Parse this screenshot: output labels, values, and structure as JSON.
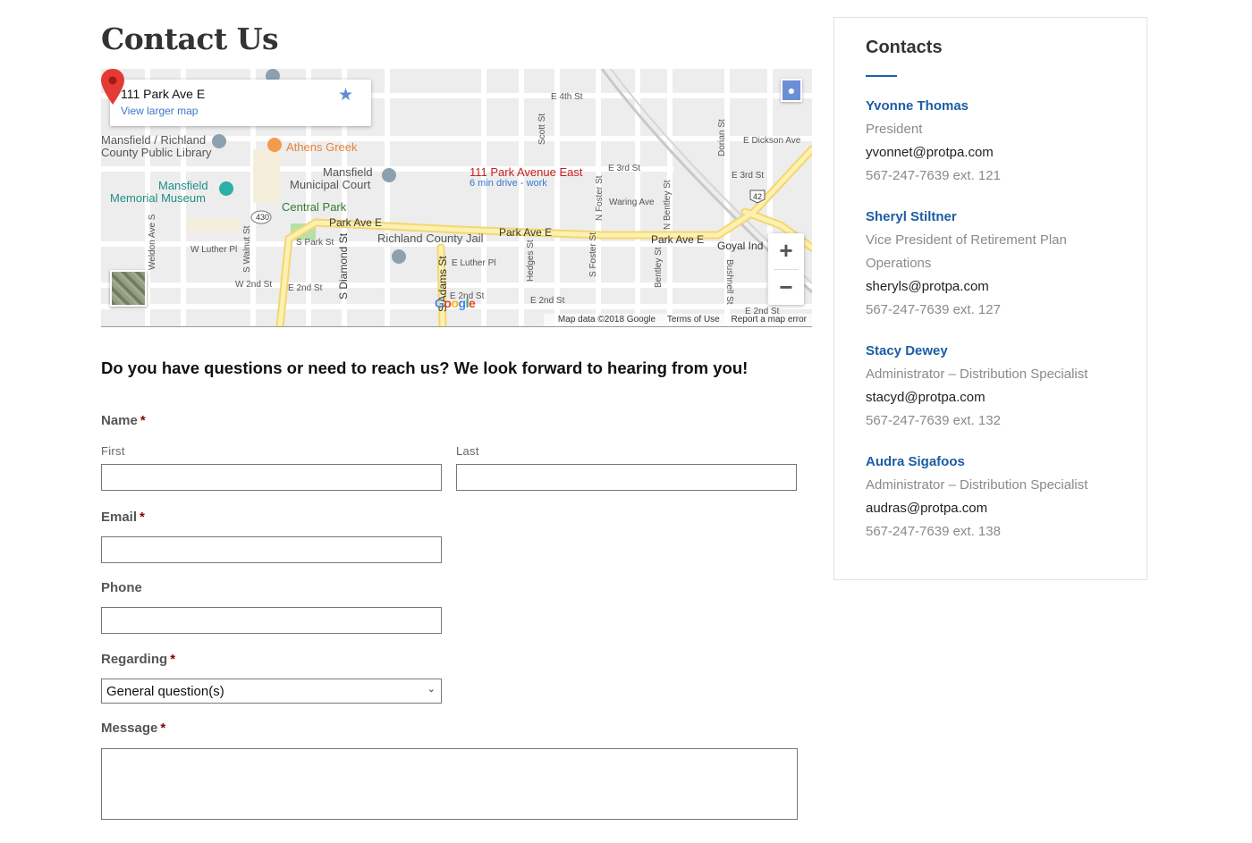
{
  "page_title": "Contact Us",
  "map": {
    "card_address": "111 Park Ave E",
    "card_link": "View larger map",
    "destination": "111 Park Avenue East",
    "destination_sub": "6 min drive - work",
    "zoom_in": "+",
    "zoom_out": "−",
    "footer_data": "Map data ©2018 Google",
    "footer_terms": "Terms of Use",
    "footer_report": "Report a map error",
    "labels": {
      "athens_greek": "Athens Greek",
      "library_1": "Mansfield / Richland",
      "library_2": "County Public Library",
      "court_1": "Mansfield",
      "court_2": "Municipal Court",
      "museum_1": "Mansfield",
      "museum_2": "Memorial Museum",
      "central_park": "Central Park",
      "jail": "Richland County Jail",
      "park_ave_1": "Park Ave E",
      "park_ave_2": "Park Ave E",
      "park_ave_3": "Park Ave E",
      "goyal": "Goyal Ind",
      "e4th": "E 4th St",
      "e3rd_1": "E 3rd St",
      "e3rd_2": "E 3rd St",
      "dickson": "E Dickson Ave",
      "waring": "Waring Ave",
      "w_luther": "W Luther Pl",
      "e_luther": "E Luther Pl",
      "w2nd": "W 2nd St",
      "e2nd_1": "E 2nd St",
      "e2nd_2": "E 2nd St",
      "e2nd_3": "E 2nd St",
      "e2nd_4": "E 2nd St",
      "s_park": "S Park St",
      "scott": "Scott St",
      "dorian": "Dorian St",
      "s_foster": "S Foster St",
      "n_foster": "N Foster St",
      "n_bentley": "N Bentley St",
      "bentley": "Bentley St",
      "hedges": "Hedges St",
      "bushnell": "Bushnell St",
      "s_walnut": "S Walnut St",
      "s_diamond": "S Diamond St",
      "s_adams": "S Adams St",
      "weldon": "Weldon Ave S",
      "route_430": "430",
      "route_42": "42",
      "google": "Google"
    }
  },
  "form": {
    "intro": "Do you have questions or need to reach us? We look forward to hearing from you!",
    "name_label": "Name",
    "first_label": "First",
    "last_label": "Last",
    "email_label": "Email",
    "phone_label": "Phone",
    "regarding_label": "Regarding",
    "regarding_value": "General question(s)",
    "message_label": "Message",
    "required_mark": "*"
  },
  "contacts": {
    "title": "Contacts",
    "people": [
      {
        "name": "Yvonne Thomas",
        "role": "President",
        "email": "yvonnet@protpa.com",
        "phone": "567-247-7639 ext. 121"
      },
      {
        "name": "Sheryl Stiltner",
        "role": "Vice President of Retirement Plan Operations",
        "email": "sheryls@protpa.com",
        "phone": "567-247-7639 ext. 127"
      },
      {
        "name": "Stacy Dewey",
        "role": "Administrator – Distribution Specialist",
        "email": "stacyd@protpa.com",
        "phone": "567-247-7639 ext. 132"
      },
      {
        "name": "Audra Sigafoos",
        "role": "Administrator – Distribution Specialist",
        "email": "audras@protpa.com",
        "phone": "567-247-7639 ext. 138"
      }
    ]
  }
}
